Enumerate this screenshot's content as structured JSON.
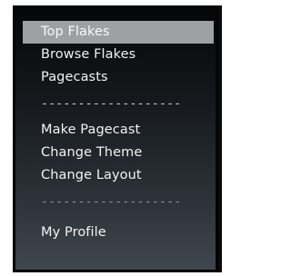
{
  "menu": {
    "items_top": [
      "Top Flakes",
      "Browse Flakes",
      "Pagecasts"
    ],
    "items_middle": [
      "Make Pagecast",
      "Change Theme",
      "Change Layout"
    ],
    "items_bottom": [
      "My Profile"
    ],
    "separator": "-------------------"
  }
}
